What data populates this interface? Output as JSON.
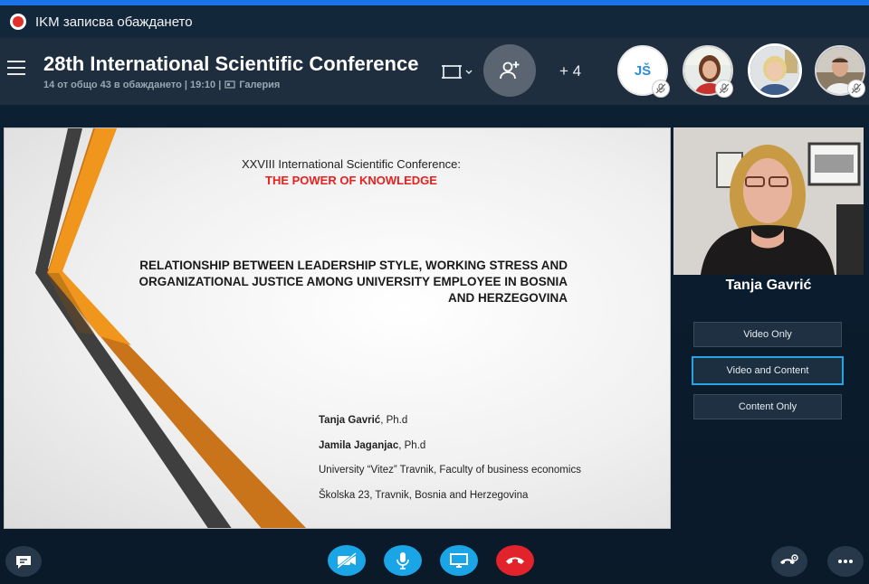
{
  "recording": {
    "text": "IKM записва обаждането"
  },
  "header": {
    "title": "28th International Scientific Conference",
    "subtitle": "14 от общо 43 в обаждането | 19:10 |",
    "gallery_label": "Галерия",
    "more_participants": "+ 4"
  },
  "participants": [
    {
      "initials": "JŠ",
      "muted": true
    },
    {
      "name": "participant-2",
      "muted": true
    },
    {
      "name": "participant-3",
      "muted": false,
      "active": true
    },
    {
      "name": "participant-4",
      "muted": true
    }
  ],
  "slide": {
    "conference_line": "XXVIII International Scientific Conference:",
    "theme": "THE POWER OF KNOWLEDGE",
    "title_lines": [
      "RELATIONSHIP BETWEEN LEADERSHIP STYLE, WORKING STRESS AND",
      "ORGANIZATIONAL JUSTICE AMONG UNIVERSITY EMPLOYEE IN BOSNIA",
      "AND HERZEGOVINA"
    ],
    "author1_name": "Tanja Gavrić",
    "author1_suffix": ", Ph.d",
    "author2_name": "Jamila Jaganjac",
    "author2_suffix": ", Ph.d",
    "university": "University “Vitez” Travnik, Faculty of business economics",
    "address": "Školska 23, Travnik,  Bosnia and Herzegovina",
    "colors": {
      "orange": "#f0961c",
      "dark_orange": "#c9741a",
      "gray": "#4a4a4a",
      "red_text": "#e8201e"
    }
  },
  "speaker": {
    "name": "Tanja Gavrić"
  },
  "view_options": [
    {
      "label": "Video Only",
      "selected": false
    },
    {
      "label": "Video and Content",
      "selected": true
    },
    {
      "label": "Content Only",
      "selected": false
    }
  ],
  "controls": {
    "chat": "chat-icon",
    "video": "video-off-icon",
    "mic": "microphone-icon",
    "share": "screen-share-icon",
    "hangup": "hang-up-icon",
    "call_settings": "call-settings-icon",
    "more": "more-icon"
  }
}
